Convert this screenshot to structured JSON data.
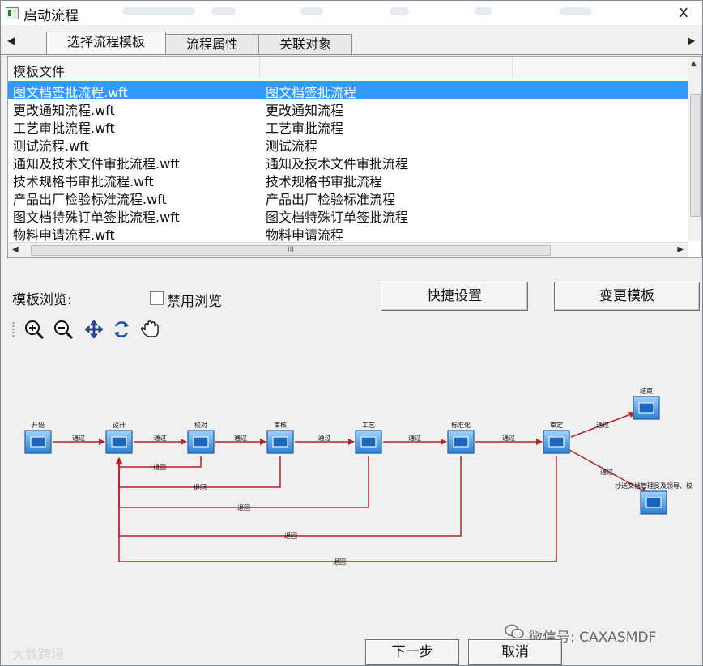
{
  "window": {
    "title": "启动流程",
    "close_label": "x"
  },
  "tabs": [
    {
      "label": "选择流程模板",
      "active": true
    },
    {
      "label": "流程属性",
      "active": false
    },
    {
      "label": "关联对象",
      "active": false
    }
  ],
  "template_list": {
    "column_headers": [
      "模板文件",
      ""
    ],
    "rows": [
      {
        "file": "图文档签批流程.wft",
        "name": "图文档签批流程",
        "selected": true
      },
      {
        "file": "更改通知流程.wft",
        "name": "更改通知流程",
        "selected": false
      },
      {
        "file": "工艺审批流程.wft",
        "name": "工艺审批流程",
        "selected": false
      },
      {
        "file": "测试流程.wft",
        "name": "测试流程",
        "selected": false
      },
      {
        "file": "通知及技术文件审批流程.wft",
        "name": "通知及技术文件审批流程",
        "selected": false
      },
      {
        "file": "技术规格书审批流程.wft",
        "name": "技术规格书审批流程",
        "selected": false
      },
      {
        "file": "产品出厂检验标准流程.wft",
        "name": "产品出厂检验标准流程",
        "selected": false
      },
      {
        "file": "图文档特殊订单签批流程.wft",
        "name": "图文档特殊订单签批流程",
        "selected": false
      },
      {
        "file": "物料申请流程.wft",
        "name": "物料申请流程",
        "selected": false
      }
    ],
    "hscroll_thumb": "III"
  },
  "preview": {
    "label": "模板浏览:",
    "disable_checkbox_label": "禁用浏览",
    "disable_checked": false,
    "quick_setup_button": "快捷设置",
    "change_template_button": "变更模板",
    "toolbar_icons": [
      "zoom-in-icon",
      "zoom-out-icon",
      "move-icon",
      "refresh-icon",
      "pan-hand-icon"
    ]
  },
  "flow_diagram": {
    "nodes": [
      "开始",
      "设计",
      "校对",
      "审核",
      "工艺",
      "标准化",
      "审定",
      "结束",
      "抄送文档管理员及领导、校"
    ],
    "pass_label": "通过",
    "return_labels": [
      "退回",
      "退回",
      "退回",
      "退回",
      "退回"
    ],
    "colors": {
      "arrow": "#b0242a",
      "node": "#3a8ad6",
      "node_border": "#1f5e9e"
    }
  },
  "footer": {
    "next_button": "下一步",
    "cancel_button": "取消"
  },
  "watermarks": {
    "left": "大数跨境",
    "right": "微信号: CAXASMDF"
  }
}
